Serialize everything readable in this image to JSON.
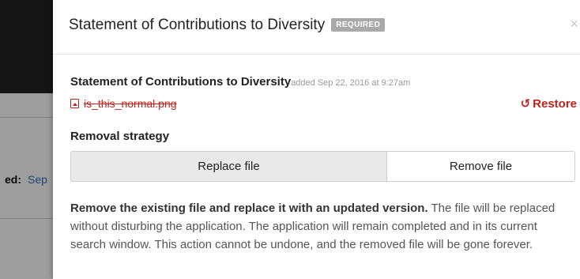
{
  "background": {
    "row_label": "ed:",
    "row_value": "Sep"
  },
  "modal": {
    "title": "Statement of Contributions to Diversity",
    "badge": "REQUIRED",
    "close_glyph": "×",
    "field": {
      "name": "Statement of Contributions to Diversity",
      "added": "added Sep 22, 2016 at 9:27am",
      "file_name": "is_this_normal.png",
      "file_icon": "image-file-icon",
      "restore_label": "Restore",
      "restore_icon": "↺"
    },
    "removal": {
      "label": "Removal strategy",
      "options": [
        "Replace file",
        "Remove file"
      ],
      "selected": "Replace file"
    },
    "description": {
      "lead": "Remove the existing file and replace it with an updated version.",
      "body": " The file will be replaced without disturbing the application. The application will remain completed and in its current search window. This action cannot be undone, and the removed file will be gone forever."
    }
  },
  "colors": {
    "accent_red": "#c2211b",
    "link_blue": "#2f6fb3",
    "badge_gray": "#a9a9a9",
    "selected_bg": "#e9e9e9"
  }
}
